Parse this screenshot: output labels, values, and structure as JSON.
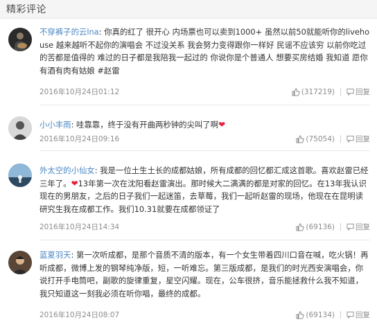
{
  "header": {
    "title": "精彩评论"
  },
  "comments": [
    {
      "username": "不穿裤子的云lna",
      "separator": ": ",
      "text": "你真的红了 很开心 内场票也可以卖到1000+ 虽然以前50就能听你的livehouse 越来越听不起你的演唱会 不过没关系 我会努力变得跟你一样好 民谣不应该穷 以前你吃过的苦都是值得的 难过的日子都是我陪我一起过的 你说你是个普通人 想要买房结婚 我知道 愿你有酒有肉有姑娘 #赵雷",
      "date": "2016年10月24日01:12",
      "likes": "(317219)",
      "reply": "回复"
    },
    {
      "username": "小小丰雨",
      "separator": ": ",
      "text": "哇靠靠，终于没有开曲两秒钟的尖叫了啊",
      "heart": "❤",
      "date": "2016年10月24日09:16",
      "likes": "(75054)",
      "reply": "回复"
    },
    {
      "username": "外太空的小仙女",
      "separator": ": ",
      "text_a": "我是一位土生土长的成都姑娘，所有成都的回忆都汇成这首歌。喜欢赵雷已经三年了。",
      "heart": "❤",
      "text_b": "13年第一次在沈阳看赵雷演出。那时候大二满满的都是对家的回忆。在13年我认识现在的男朋友，之后的日子我们一起迷笛，去草莓，我们一起听赵雷的现场，他现在在昆明读研究生我在成都工作。我们10.31就要在成都领证了",
      "date": "2016年10月24日14:34",
      "likes": "(69136)",
      "reply": "回复"
    },
    {
      "username": "蓝夏羽天",
      "separator": ": ",
      "text": "第一次听成都，是那个音质不清的版本，有一个女生带着四川口音在喊，吃火锅！再听成都，微博上发的钢琴纯净版，短，一听难忘。第三版成都，是我们的时光西安演唱会，你说打开手电筒吧，副歌的旋律重复，星空闪耀。现在，公车很挤，音乐能拯救什么我不知道，我只知道这一刻我必须在听你唱，最终的成都。",
      "date": "2016年10月24日08:07",
      "likes": "(69134)",
      "reply": "回复"
    }
  ],
  "icons": {
    "like": "thumbs-up-icon",
    "reply": "reply-icon"
  },
  "colors": {
    "username": "#4a87c4",
    "heart": "#e8203e",
    "meta": "#8c8c8c"
  }
}
